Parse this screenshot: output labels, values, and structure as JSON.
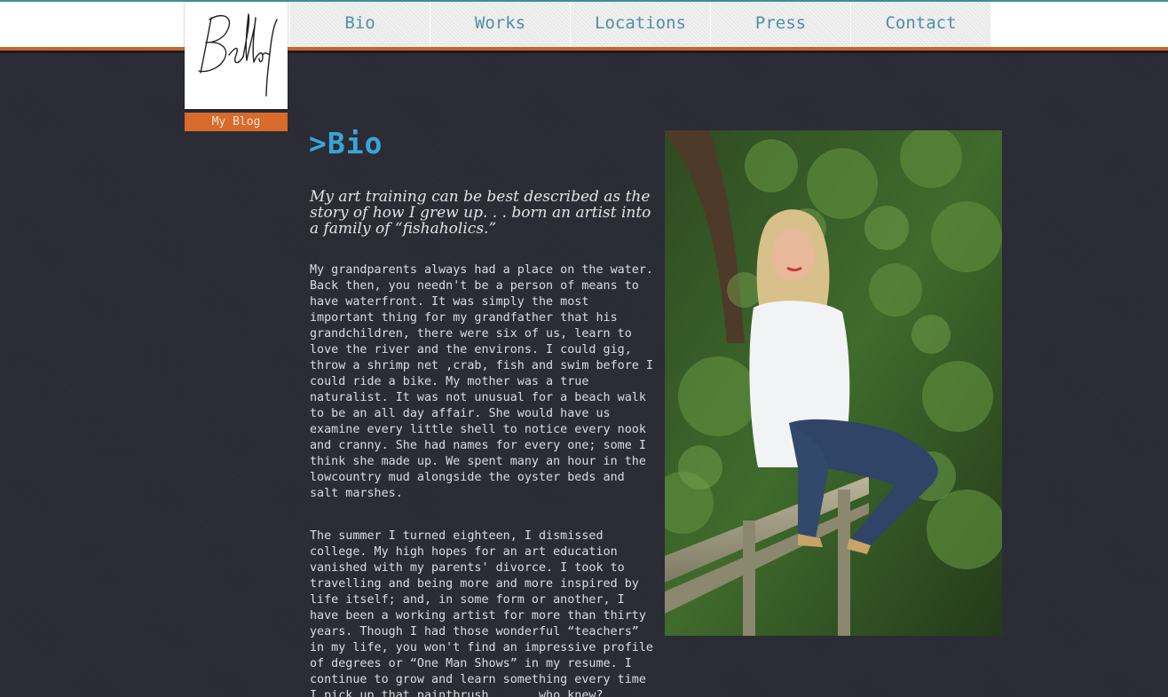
{
  "header": {
    "logo_alt": "Bellamy",
    "blog_label": "My Blog"
  },
  "nav": {
    "items": [
      {
        "label": "Bio"
      },
      {
        "label": "Works"
      },
      {
        "label": "Locations"
      },
      {
        "label": "Press"
      },
      {
        "label": "Contact"
      }
    ]
  },
  "bio": {
    "title": ">Bio",
    "intro": "My art training can be best described as the story of how I grew up. . . born an artist into a family of “fishaholics.”",
    "paragraphs": [
      "My grandparents always had a place on the water. Back then, you needn't be a person of means to have waterfront. It was simply the most important thing for my grandfather that his grandchildren, there were six of us, learn to love the river and the environs. I could gig, throw a shrimp net ,crab, fish and swim before I could ride a bike. My mother was a true naturalist. It was not unusual for a beach walk to be an all day affair. She would have us examine every little shell to notice every nook and cranny. She had names for every one; some I think she made up. We spent many an hour in the lowcountry mud alongside the oyster beds and salt marshes.",
      "The summer I turned eighteen, I dismissed college. My high hopes for an art education vanished with my parents' divorce. I took to travelling and being more and more inspired by life itself; and, in some form or another, I have been a working artist for more than thirty years. Though I had those wonderful “teachers” in my life, you won't find an impressive profile of degrees or “One Man Shows” in my resume. I continue to grow and learn something every time I pick up that paintbrush . . . who knew?"
    ]
  },
  "colors": {
    "accent_orange": "#d86a2b",
    "title_blue": "#38a6d6",
    "nav_text": "#4f8fa6",
    "background": "#2b2b36"
  },
  "icons": {
    "logo": "signature-logo",
    "photo": "artist-portrait-photo"
  }
}
